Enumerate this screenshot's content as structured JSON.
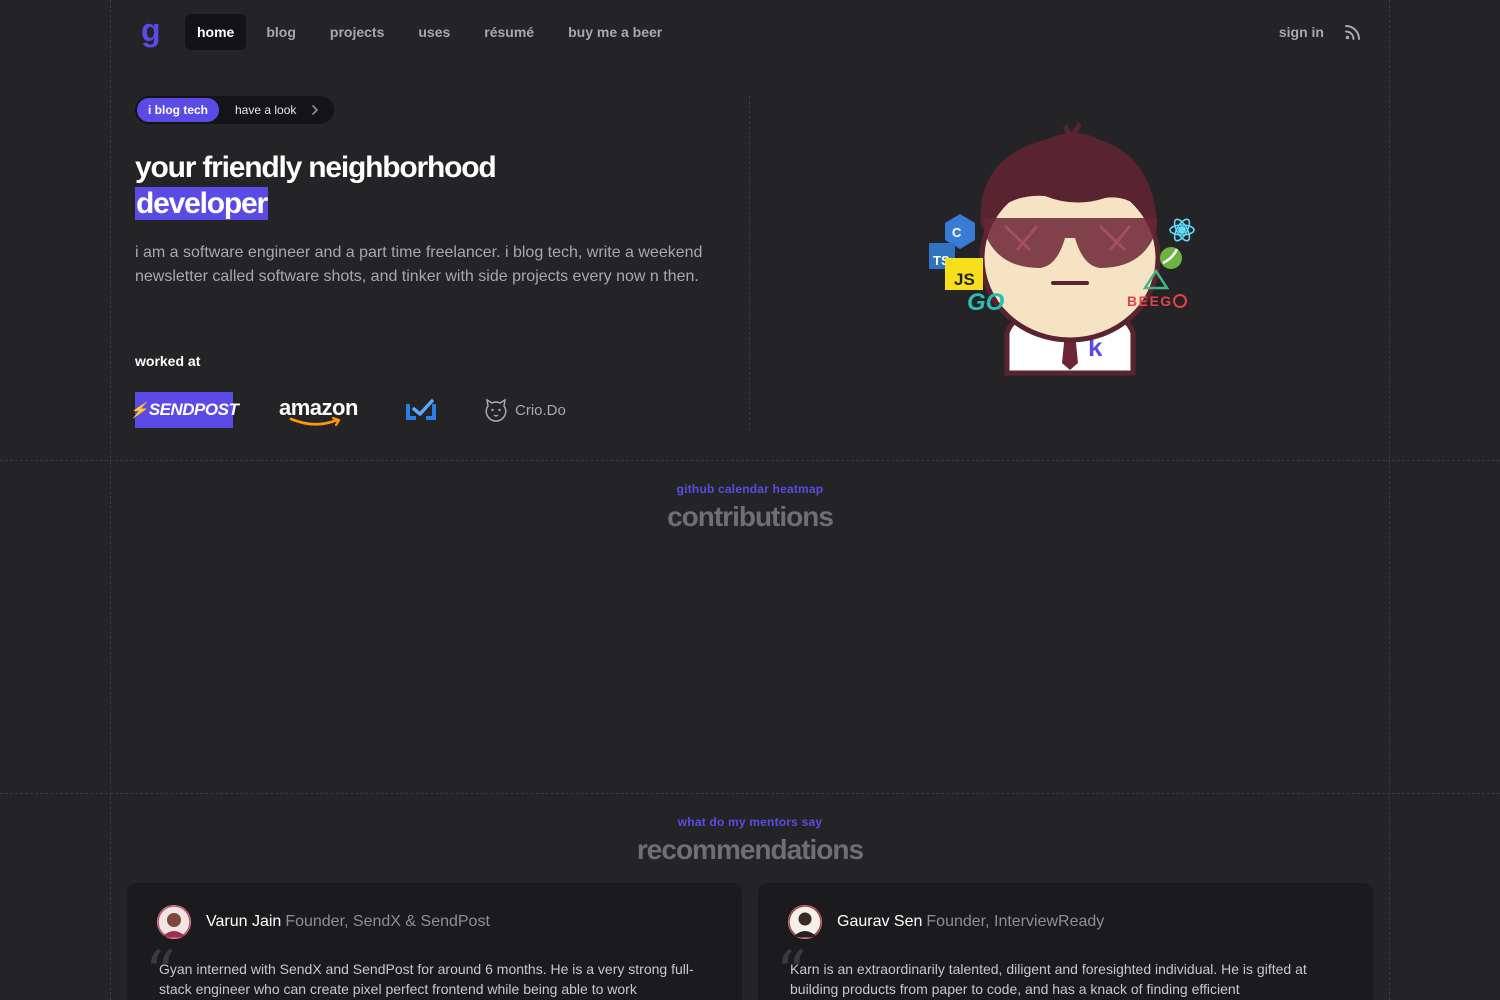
{
  "nav": {
    "logo": "g",
    "links": [
      "home",
      "blog",
      "projects",
      "uses",
      "résumé",
      "buy me a beer"
    ],
    "sign_in": "sign in"
  },
  "hero": {
    "pill_tag": "i blog tech",
    "pill_text": "have a look",
    "title_line1": "your friendly neighborhood",
    "title_line2": "developer",
    "intro": "i am a software engineer and a part time freelancer. i blog tech, write a weekend newsletter called software shots, and tinker with side projects every now n then.",
    "worked_at": "worked at",
    "companies": [
      "SENDPOST",
      "amazon",
      "Crio.Do"
    ]
  },
  "contributions": {
    "eyebrow": "github calendar heatmap",
    "title": "contributions"
  },
  "recommendations": {
    "eyebrow": "what do my mentors say",
    "title": "recommendations",
    "cards": [
      {
        "name": "Varun Jain",
        "role": "Founder, SendX & SendPost",
        "text": "Gyan interned with SendX and SendPost for around 6 months. He is a very strong full-stack engineer who can create pixel perfect frontend while being able to work"
      },
      {
        "name": "Gaurav Sen",
        "role": "Founder, InterviewReady",
        "text": "Karn is an extraordinarily talented, diligent and foresighted individual. He is gifted at building products from paper to code, and has a knack of finding efficient"
      }
    ]
  },
  "colors": {
    "accent": "#5b4be6",
    "background": "#242427",
    "card": "#1b1b1e"
  }
}
